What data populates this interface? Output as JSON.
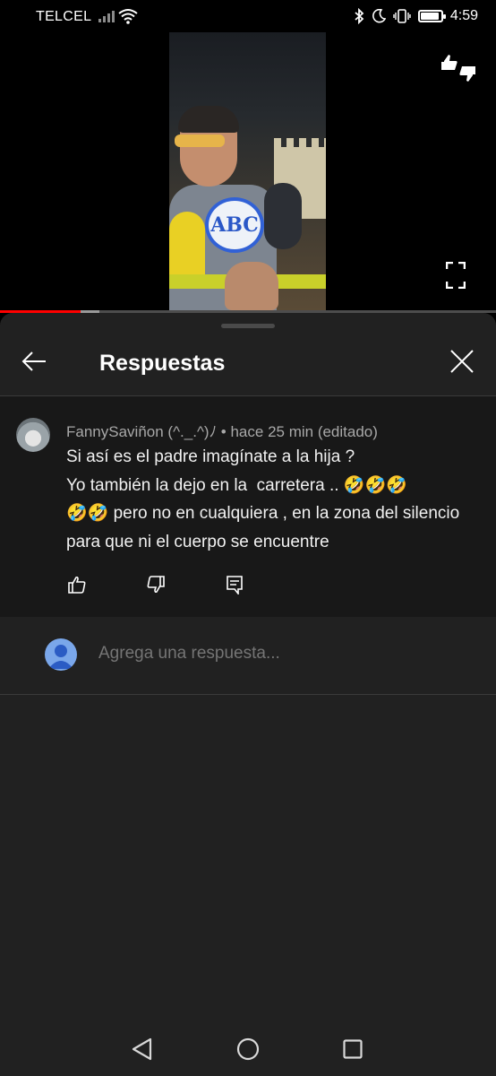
{
  "status_bar": {
    "carrier": "TELCEL",
    "time": "4:59",
    "icons": [
      "signal-icon",
      "wifi-icon",
      "bluetooth-icon",
      "moon-icon",
      "vibrate-icon",
      "battery-icon"
    ]
  },
  "video": {
    "logo_text": "ABC",
    "progress_fraction": 0.162,
    "buffered_fraction": 0.2,
    "icons": [
      "feedback-icon",
      "fullscreen-icon"
    ]
  },
  "sheet": {
    "title": "Respuestas",
    "back_icon": "arrow-left-icon",
    "close_icon": "close-icon"
  },
  "comment": {
    "author": "FannySaviñon (^._.^)ﾉ",
    "time": "hace 25 min (editado)",
    "meta": "FannySaviñon (^._.^)ﾉ • hace 25 min (editado)",
    "text": "Si así es el padre imagínate a la hija ?\nYo también la dejo en la  carretera .. 🤣🤣🤣\n🤣🤣 pero no en cualquiera , en la zona del silencio para que ni el cuerpo se encuentre",
    "actions": [
      "thumbs-up-icon",
      "thumbs-down-icon",
      "reply-icon"
    ]
  },
  "reply": {
    "placeholder": "Agrega una respuesta..."
  },
  "nav": {
    "icons": [
      "back-triangle-icon",
      "home-circle-icon",
      "recents-square-icon"
    ]
  },
  "colors": {
    "progress_red": "#ff0000",
    "sheet_bg": "#212121",
    "comment_bg": "#181818",
    "avatar_blue": "#7aa7ea"
  }
}
